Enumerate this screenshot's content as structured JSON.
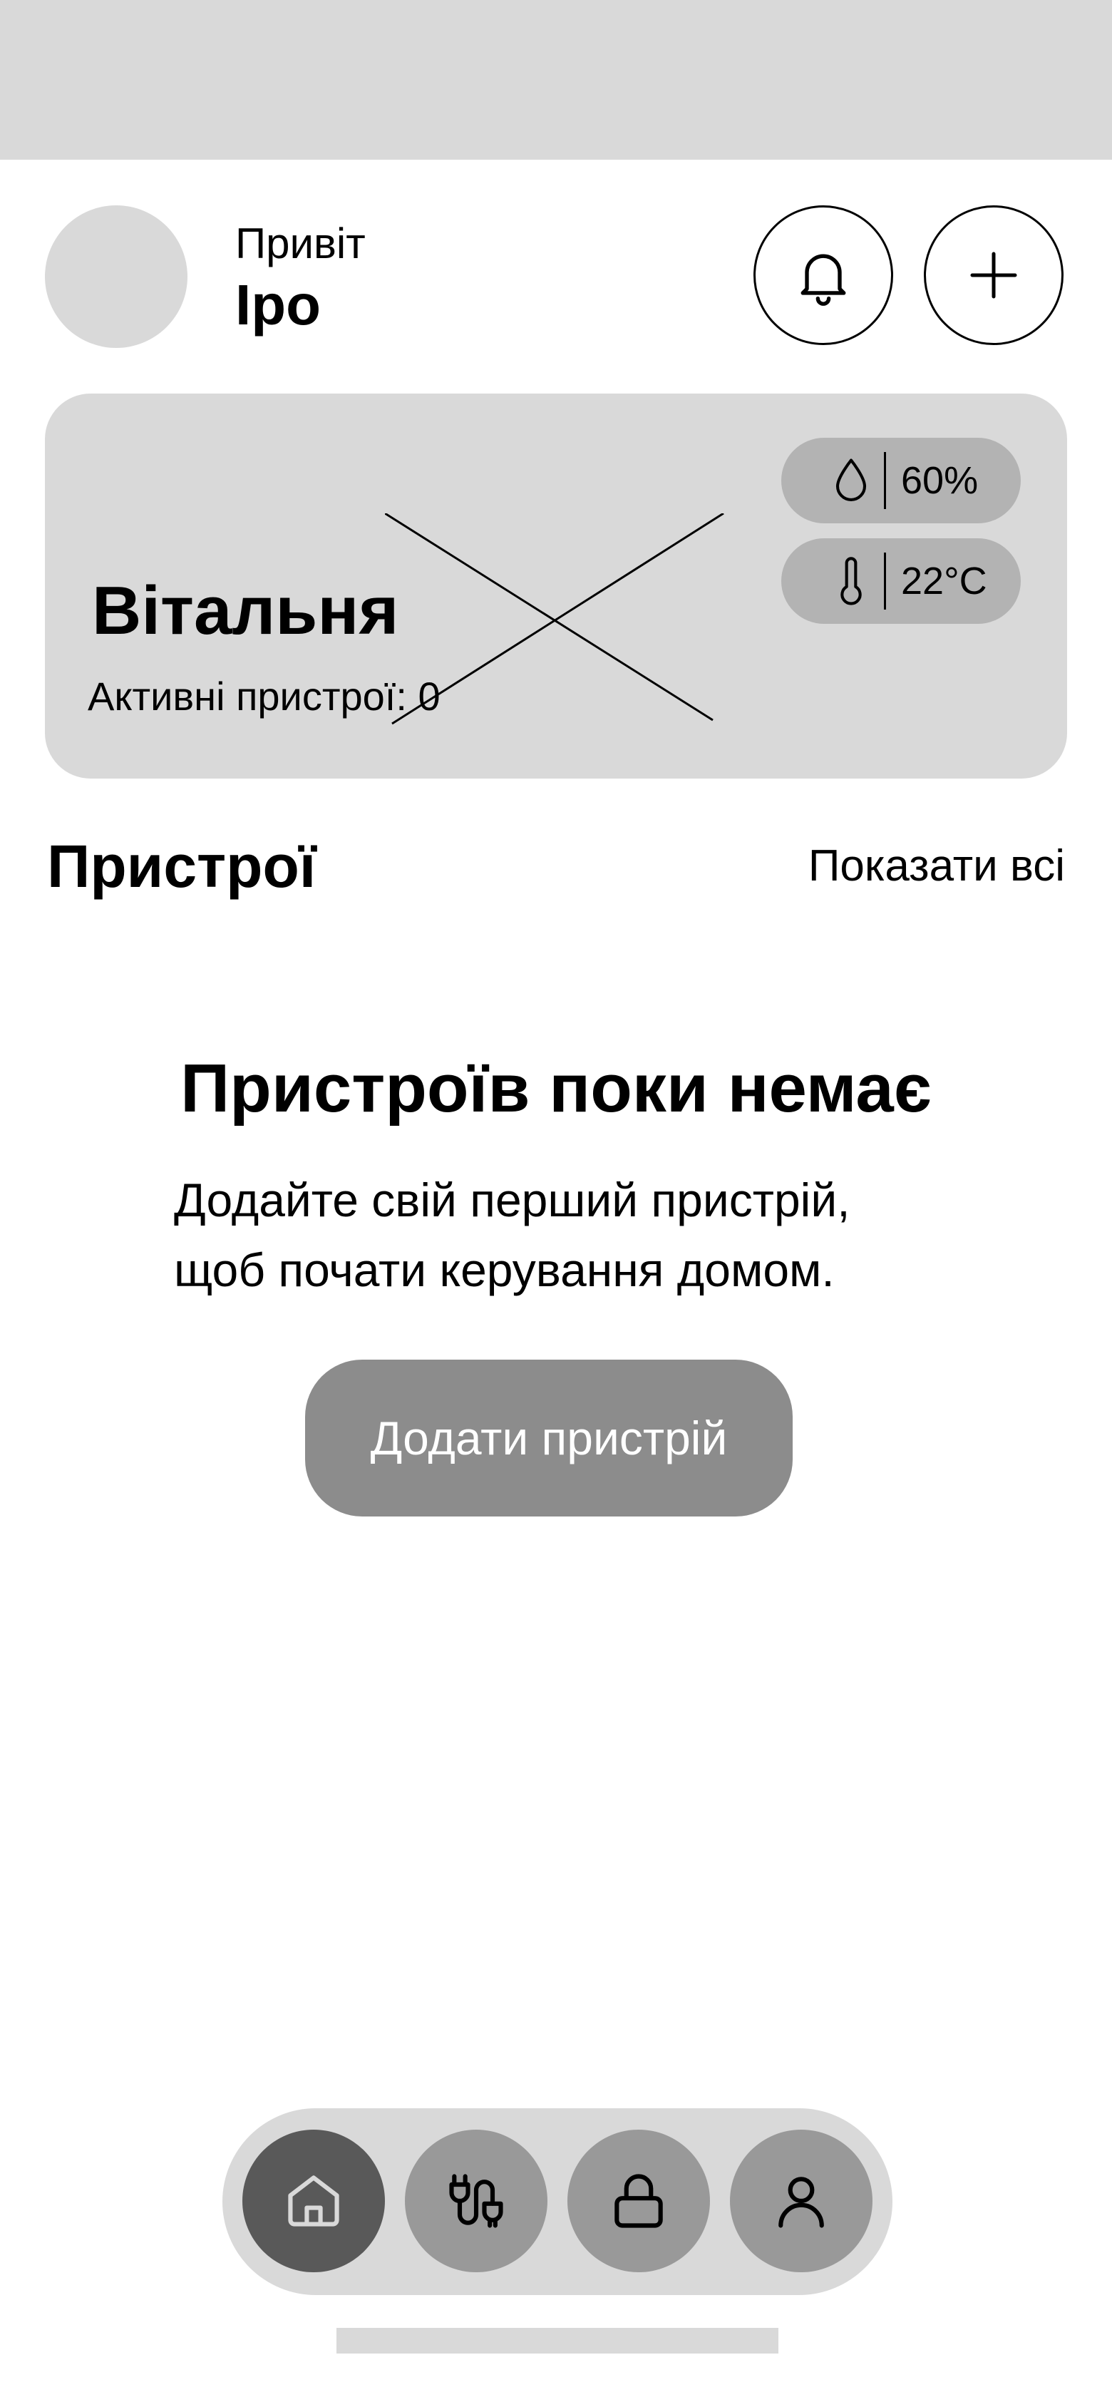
{
  "header": {
    "greeting": "Привіт",
    "username": "Іро",
    "icons": {
      "notifications": "bell-icon",
      "add": "plus-icon"
    }
  },
  "room_card": {
    "name": "Вітальня",
    "active_devices_text": "Активні пристрої: 0",
    "humidity": {
      "icon": "droplet-icon",
      "value": "60%"
    },
    "temperature": {
      "icon": "thermometer-icon",
      "value": "22°C"
    }
  },
  "devices_section": {
    "title": "Пристрої",
    "show_all_label": "Показати всі"
  },
  "empty_state": {
    "title": "Пристроїв поки немає",
    "description_lines": [
      "Додайте свій перший пристрій,",
      "щоб почати керування домом."
    ],
    "button_label": "Додати пристрій"
  },
  "bottom_nav": {
    "items": [
      {
        "icon": "home-icon",
        "active": true
      },
      {
        "icon": "plug-icon",
        "active": false
      },
      {
        "icon": "lock-icon",
        "active": false
      },
      {
        "icon": "user-icon",
        "active": false
      }
    ]
  },
  "colors": {
    "placeholder_gray": "#d9d9d9",
    "pill_gray": "#b3b3b3",
    "button_gray": "#8c8c8c",
    "nav_active": "#595959",
    "nav_inactive": "#999999"
  }
}
